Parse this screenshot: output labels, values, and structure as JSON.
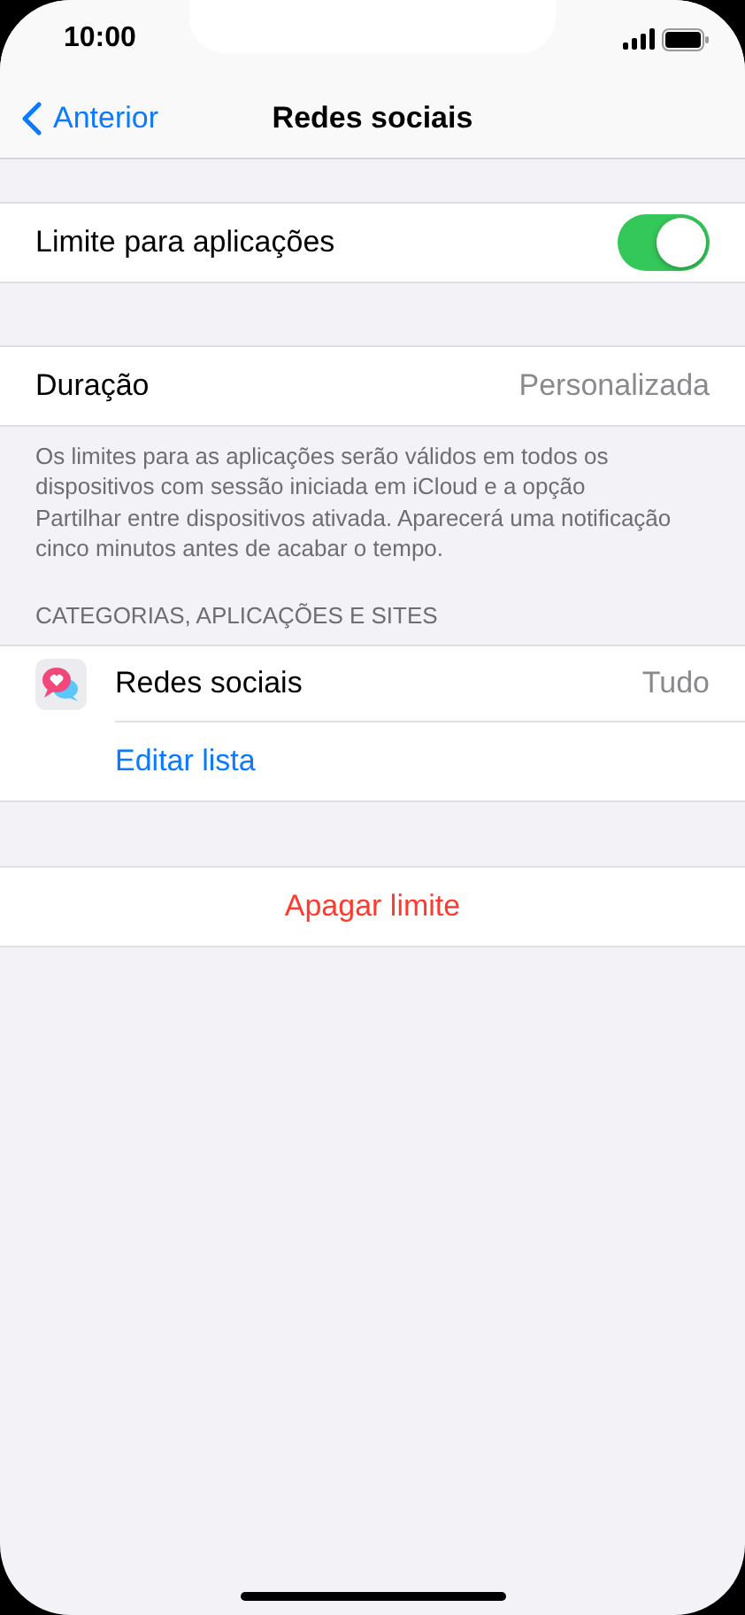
{
  "status_bar": {
    "time": "10:00"
  },
  "nav": {
    "back": "Anterior",
    "title": "Redes sociais"
  },
  "limit_toggle": {
    "label": "Limite para aplicações",
    "on": true
  },
  "duration": {
    "label": "Duração",
    "value": "Personalizada"
  },
  "footer_note": "Os limites para as aplicações serão válidos em todos os dispositivos com sessão iniciada em iCloud e a opção Partilhar entre dispositivos ativada. Aparecerá uma notificação cinco minutos antes de acabar o tempo.",
  "categories": {
    "header": "CATEGORIAS, APLICAÇÕES E SITES",
    "items": [
      {
        "label": "Redes sociais",
        "value": "Tudo"
      }
    ],
    "edit_link": "Editar lista"
  },
  "delete_button": "Apagar limite"
}
